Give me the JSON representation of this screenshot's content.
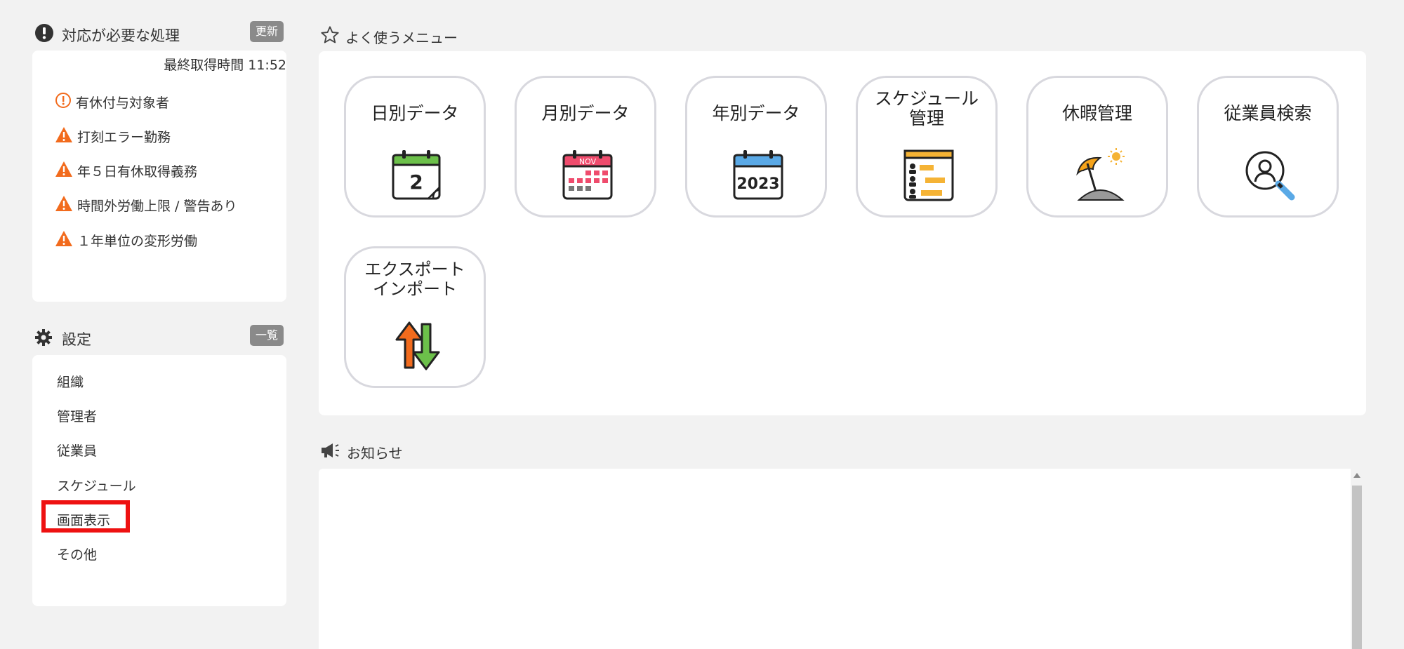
{
  "alerts": {
    "title": "対応が必要な処理",
    "refresh_label": "更新",
    "last_fetch": "最終取得時間 11:52",
    "items": [
      {
        "label": "有休付与対象者",
        "icon": "info-circle-icon"
      },
      {
        "label": "打刻エラー勤務",
        "icon": "warning-icon"
      },
      {
        "label": "年５日有休取得義務",
        "icon": "warning-icon"
      },
      {
        "label": "時間外労働上限 / 警告あり",
        "icon": "warning-icon"
      },
      {
        "label": "１年単位の変形労働",
        "icon": "warning-icon"
      }
    ]
  },
  "settings": {
    "title": "設定",
    "list_label": "一覧",
    "items": [
      {
        "label": "組織"
      },
      {
        "label": "管理者"
      },
      {
        "label": "従業員"
      },
      {
        "label": "スケジュール"
      },
      {
        "label": "画面表示"
      },
      {
        "label": "その他"
      }
    ]
  },
  "favorites": {
    "title": "よく使うメニュー",
    "tiles": [
      {
        "label": "日別データ",
        "icon": "daily-calendar-icon"
      },
      {
        "label": "月別データ",
        "icon": "monthly-calendar-icon",
        "icon_text": "NOV"
      },
      {
        "label": "年別データ",
        "icon": "yearly-calendar-icon",
        "icon_text": "2023"
      },
      {
        "label_line1": "スケジュール",
        "label_line2": "管理",
        "icon": "schedule-icon"
      },
      {
        "label": "休暇管理",
        "icon": "beach-umbrella-icon"
      },
      {
        "label": "従業員検索",
        "icon": "employee-search-icon"
      },
      {
        "label_line1": "エクスポート",
        "label_line2": "インポート",
        "icon": "export-import-icon"
      }
    ]
  },
  "news": {
    "title": "お知らせ"
  },
  "colors": {
    "warning": "#f26b1d",
    "highlight": "#ee1111",
    "calendar_green": "#6cc04a",
    "calendar_pink": "#ef4c6d",
    "calendar_blue": "#5aa9e6",
    "schedule_orange": "#f5b335"
  }
}
